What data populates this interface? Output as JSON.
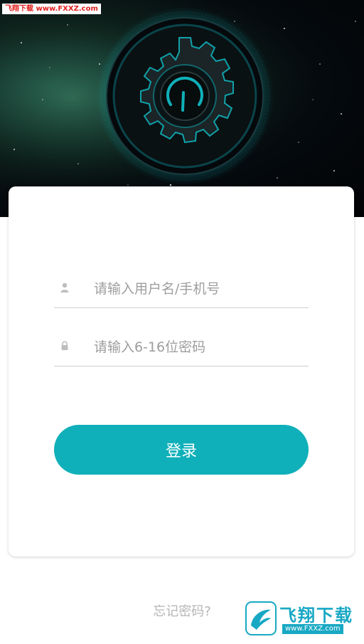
{
  "watermark": {
    "top_text": "飞翔下载 www.FXXZ.com",
    "bottom_name": "飞翔下载",
    "bottom_url": "www.FXXZ.com"
  },
  "form": {
    "username": {
      "icon": "user-icon",
      "value": "",
      "placeholder": "请输入用户名/手机号"
    },
    "password": {
      "icon": "lock-icon",
      "value": "",
      "placeholder": "请输入6-16位密码"
    },
    "login_label": "登录"
  },
  "forgot_label": "忘记密码?",
  "colors": {
    "accent": "#0fb0b9",
    "placeholder": "#9e9e9e",
    "divider": "#cfcfcf",
    "forgot_text": "#b5b5b5"
  }
}
